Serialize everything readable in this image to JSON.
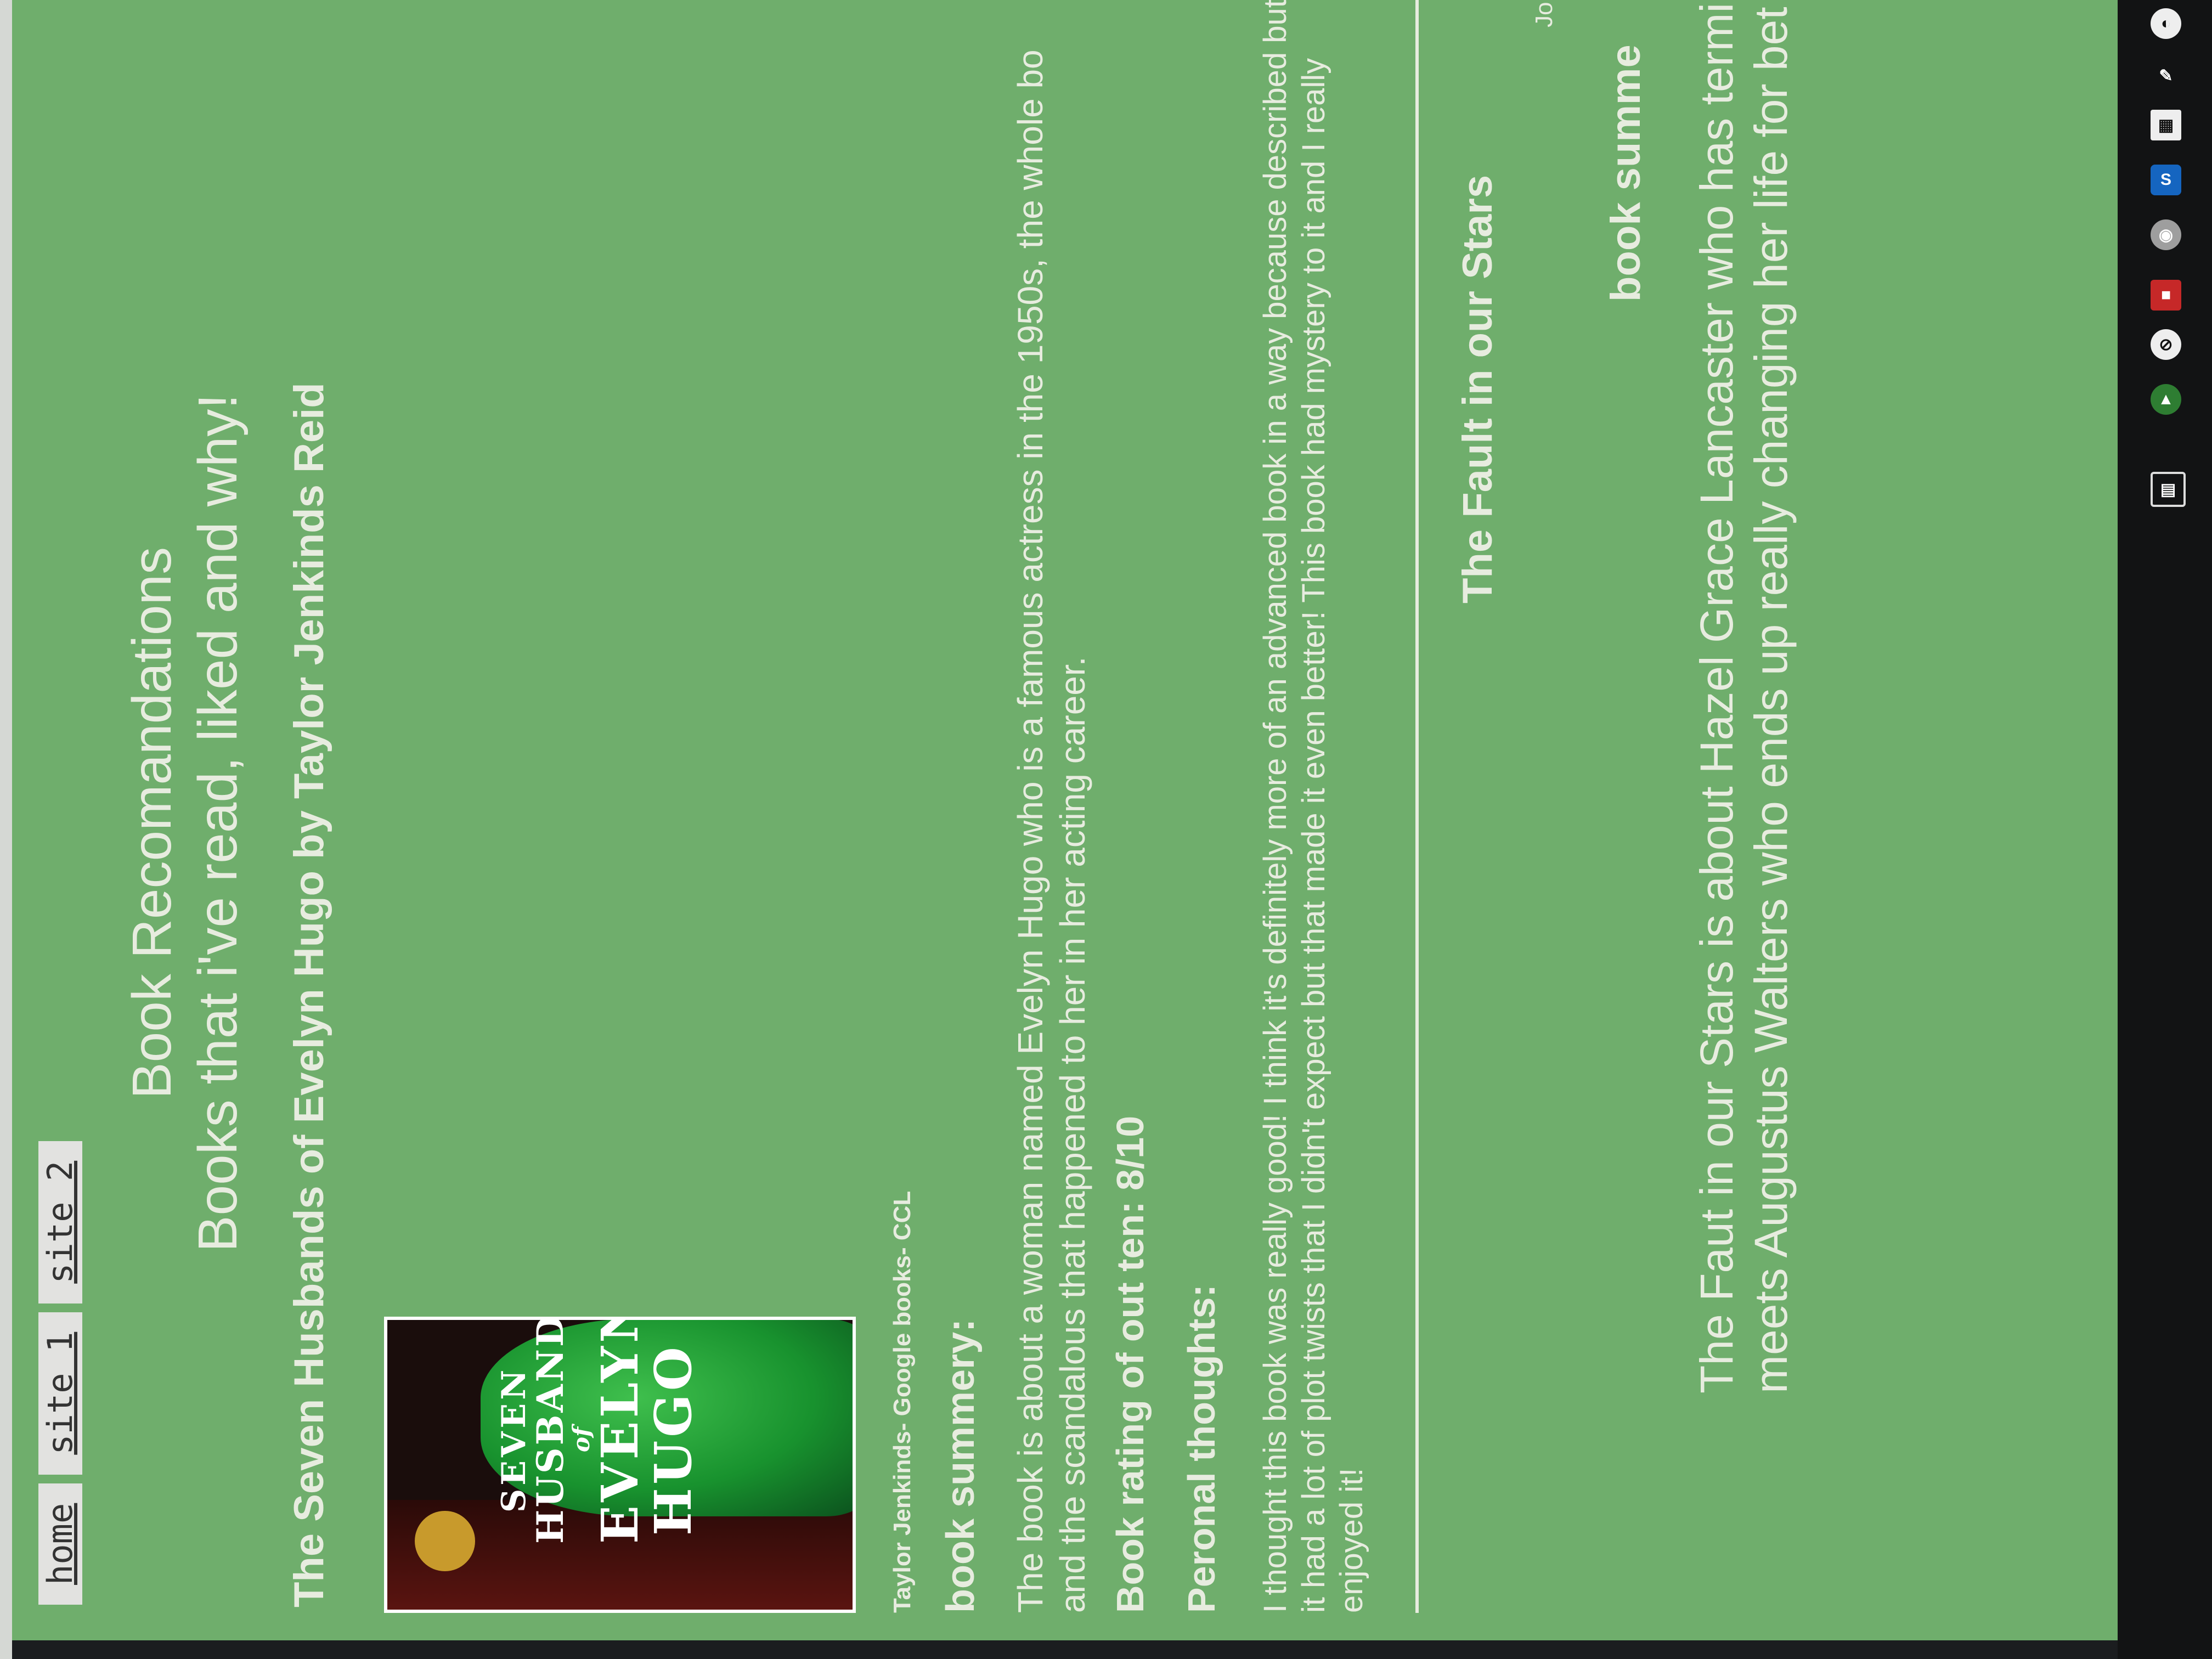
{
  "nav": {
    "home": "home",
    "site1": "site 1",
    "site2": "site 2"
  },
  "header": {
    "title": "Book Recomandations",
    "subtitle": "Books that i've read, liked and why!"
  },
  "book1": {
    "title": "The Seven Husbands of Evelyn Hugo by Taylor Jenkinds Reid",
    "cover": {
      "line1": "SEVEN",
      "line2": "HUSBANDS",
      "line3": "of",
      "line4": "EVELYN",
      "line5": "HUGO"
    },
    "credit": "Taylor Jenkinds- Google books- CCL",
    "summary_heading": "book summery:",
    "summary_text": "The book is about a woman named Evelyn Hugo who is a famous actress in the 1950s, the whole bo and the scandalous that happened to her in her acting career.",
    "rating": "Book rating of out ten: 8/10",
    "thoughts_heading": "Peronal thoughts:",
    "thoughts_text": "I thought this book was really good! I think it's definitely more of an advanced book in a way because described but it had a lot of plot twists that I didn't expect but that made it even better! This book had mystery to it and I really enjoyed it!"
  },
  "book2": {
    "title": "The Fault in our Stars",
    "author_partial": "Jo",
    "summary_heading": "book summe",
    "text": "The Faut in our Stars is about Hazel Grace Lancaster who has terminal lu cancer, she meets Augustus Walters who ends up really changing her life for bet"
  },
  "taskbar": {
    "icons": [
      "news-icon",
      "app-icon",
      "security-icon",
      "app-icon-2",
      "chrome-icon",
      "s-icon",
      "qr-icon",
      "pen-icon",
      "google-icon"
    ]
  }
}
